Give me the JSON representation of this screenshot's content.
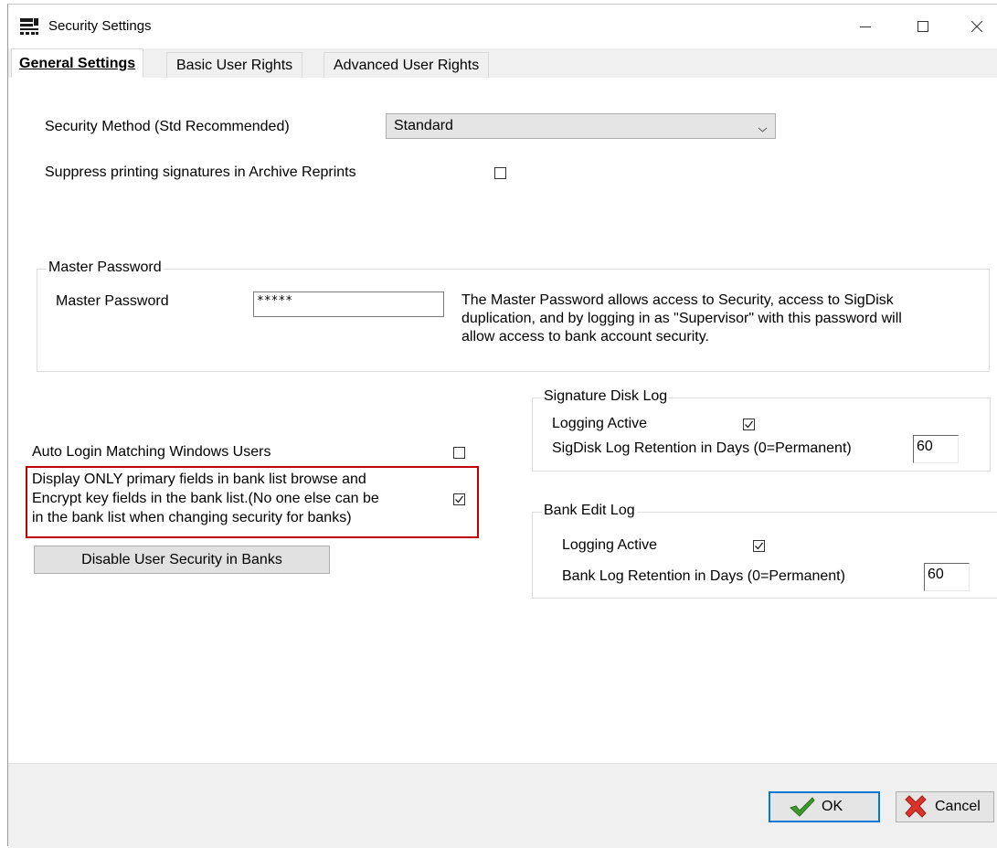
{
  "window": {
    "title": "Security Settings",
    "controls": {
      "minimize": "minimize",
      "maximize": "maximize",
      "close": "close"
    }
  },
  "tabs": [
    {
      "label": "General Settings",
      "active": true
    },
    {
      "label": "Basic User Rights",
      "active": false
    },
    {
      "label": "Advanced User Rights",
      "active": false
    }
  ],
  "security_method": {
    "label": "Security Method (Std Recommended)",
    "value": "Standard"
  },
  "suppress_signatures": {
    "label": "Suppress printing signatures in Archive Reprints",
    "checked": false
  },
  "master_password_group": {
    "legend": "Master Password",
    "label": "Master Password",
    "value": "*****",
    "description": "The Master Password allows access to Security, access to SigDisk duplication, and by logging in as \"Supervisor\" with this password will allow access to bank account security."
  },
  "auto_login": {
    "label": "Auto Login Matching Windows Users",
    "checked": false
  },
  "display_primary": {
    "lines": [
      "Display ONLY primary fields in bank list browse and",
      "Encrypt key fields in the bank list.(No one else can be",
      "in the bank list when changing security for banks)"
    ],
    "checked": true
  },
  "disable_security_button": "Disable User Security in Banks",
  "signature_disk_log": {
    "legend": "Signature Disk Log",
    "logging_label": "Logging Active",
    "logging_checked": true,
    "retention_label": "SigDisk Log Retention in Days (0=Permanent)",
    "retention_value": "60"
  },
  "bank_edit_log": {
    "legend": "Bank Edit Log",
    "logging_label": "Logging Active",
    "logging_checked": true,
    "retention_label": "Bank Log Retention in Days (0=Permanent)",
    "retention_value": "60"
  },
  "footer": {
    "ok_label": "OK",
    "cancel_label": "Cancel"
  },
  "colors": {
    "highlight_border": "#c00000",
    "ok_focus": "#0078d7",
    "check_green": "#3c9a2a",
    "cancel_red": "#d9342b"
  }
}
